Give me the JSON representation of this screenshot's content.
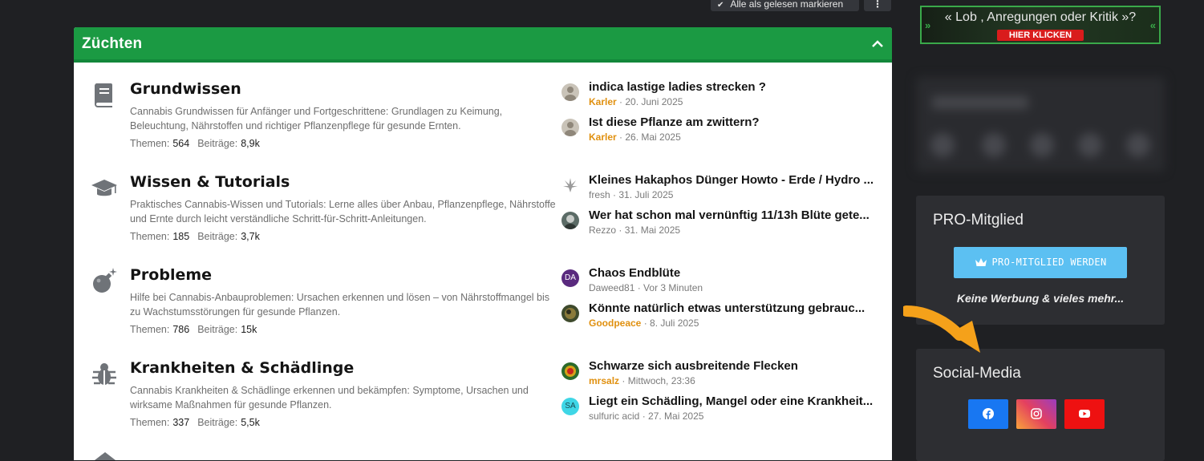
{
  "toolbar": {
    "mark_read_label": "Alle als gelesen markieren",
    "more_label": "⋮"
  },
  "category": {
    "title": "Züchten"
  },
  "nodes": [
    {
      "title": "Grundwissen",
      "desc": "Cannabis Grundwissen für Anfänger und Fortgeschrittene: Grundlagen zu Keimung, Beleuchtung, Nährstoffen und richtiger Pflanzenpflege für gesunde Ernten.",
      "stats": {
        "threads_label": "Themen:",
        "threads": "564",
        "posts_label": "Beiträge:",
        "posts": "8,9k"
      },
      "icon": "book-icon",
      "latest": [
        {
          "title": "indica lastige ladies strecken ?",
          "user": "Karler",
          "date": "20. Juni 2025",
          "avatar": "photo"
        },
        {
          "title": "Ist diese Pflanze am zwittern?",
          "user": "Karler",
          "date": "26. Mai 2025",
          "avatar": "photo"
        }
      ]
    },
    {
      "title": "Wissen & Tutorials",
      "desc": "Praktisches Cannabis-Wissen und Tutorials: Lerne alles über Anbau, Pflanzenpflege, Nährstoffe und Ernte durch leicht verständliche Schritt-für-Schritt-Anleitungen.",
      "stats": {
        "threads_label": "Themen:",
        "threads": "185",
        "posts_label": "Beiträge:",
        "posts": "3,7k"
      },
      "icon": "graduation-cap-icon",
      "latest": [
        {
          "title": "Kleines Hakaphos Dünger Howto - Erde / Hydro ...",
          "user": "fresh",
          "date": "31. Juli 2025",
          "avatar": "leaf"
        },
        {
          "title": "Wer hat schon mal vernünftig 11/13h Blüte gete...",
          "user": "Rezzo",
          "date": "31. Mai 2025",
          "avatar": "photo"
        }
      ]
    },
    {
      "title": "Probleme",
      "desc": "Hilfe bei Cannabis-Anbauproblemen: Ursachen erkennen und lösen – von Nährstoffmangel bis zu Wachstumsstörungen für gesunde Pflanzen.",
      "stats": {
        "threads_label": "Themen:",
        "threads": "786",
        "posts_label": "Beiträge:",
        "posts": "15k"
      },
      "icon": "bomb-icon",
      "latest": [
        {
          "title": "Chaos Endblüte",
          "user": "Daweed81",
          "date": "Vor 3 Minuten",
          "avatar": "DA"
        },
        {
          "title": "Könnte natürlich etwas unterstützung gebrauc...",
          "user": "Goodpeace",
          "date": "8. Juli 2025",
          "avatar": "photo"
        }
      ]
    },
    {
      "title": "Krankheiten & Schädlinge",
      "desc": "Cannabis Krankheiten & Schädlinge erkennen und bekämpfen: Symptome, Ursachen und wirksame Maßnahmen für gesunde Pflanzen.",
      "stats": {
        "threads_label": "Themen:",
        "threads": "337",
        "posts_label": "Beiträge:",
        "posts": "5,5k"
      },
      "icon": "bug-icon",
      "latest": [
        {
          "title": "Schwarze sich ausbreitende Flecken",
          "user": "mrsalz",
          "date": "Mittwoch, 23:36",
          "avatar": "photo"
        },
        {
          "title": "Liegt ein Schädling, Mangel oder eine Krankheit...",
          "user": "sulfuric acid",
          "date": "27. Mai 2025",
          "avatar": "SA"
        }
      ]
    }
  ],
  "sidebar": {
    "banner": {
      "text": "« Lob , Anregungen oder Kritik »?",
      "cta": "HIER KLICKEN"
    },
    "pro": {
      "title": "PRO-Mitglied",
      "button": "PRO-MITGLIED WERDEN",
      "subtitle": "Keine Werbung & vieles mehr..."
    },
    "social": {
      "title": "Social-Media",
      "links": [
        "facebook-icon",
        "instagram-icon",
        "youtube-icon"
      ]
    }
  },
  "colors": {
    "accent": "#1b9a43",
    "orange_user": "#e0900f",
    "pro_button": "#5cc0f2",
    "facebook": "#1877f2",
    "youtube": "#ee1111"
  }
}
